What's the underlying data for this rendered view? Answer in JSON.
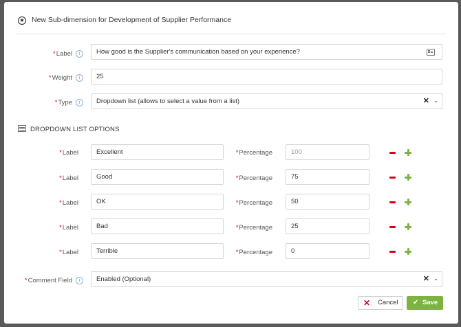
{
  "header": {
    "title": "New Sub-dimension for Development of Supplier Performance"
  },
  "fields": {
    "label": {
      "label": "Label",
      "value": "How good is the Supplier's communication based on your experience?"
    },
    "weight": {
      "label": "Weight",
      "value": "25"
    },
    "type": {
      "label": "Type",
      "value": "Dropdown list (allows to select a value from a list)"
    }
  },
  "dropdown_section": {
    "title": "DROPDOWN LIST OPTIONS",
    "row_label": "Label",
    "percentage_label": "Percentage",
    "options": [
      {
        "label": "Excellent",
        "percentage": "100"
      },
      {
        "label": "Good",
        "percentage": "75"
      },
      {
        "label": "OK",
        "percentage": "50"
      },
      {
        "label": "Bad",
        "percentage": "25"
      },
      {
        "label": "Terrible",
        "percentage": "0"
      }
    ]
  },
  "comment_field": {
    "label": "Comment Field",
    "value": "Enabled (Optional)"
  },
  "footer": {
    "cancel_label": "Cancel",
    "save_label": "Save"
  },
  "colors": {
    "required": "#d0021b",
    "accent_green": "#7cb342",
    "remove_red": "#d0021b"
  },
  "icons": [
    "star-icon",
    "info-icon",
    "text-format-icon",
    "clear-icon",
    "chevron-down-icon",
    "list-icon",
    "minus-icon",
    "plus-icon",
    "close-icon",
    "check-icon"
  ]
}
